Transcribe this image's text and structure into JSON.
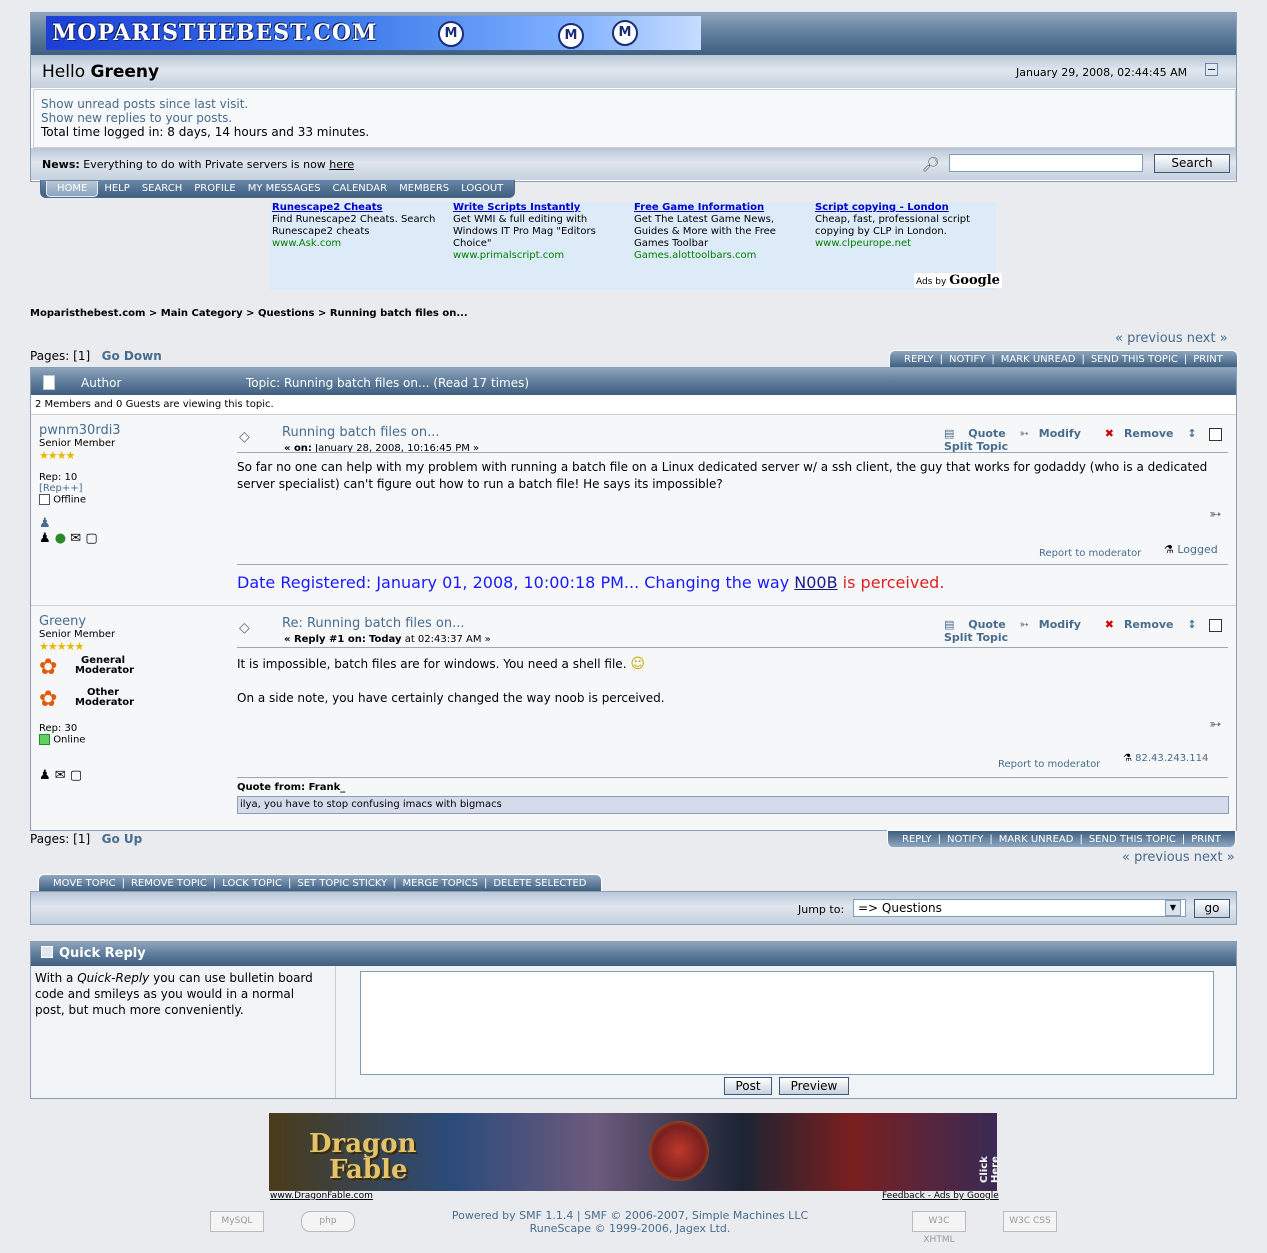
{
  "header": {
    "logo_text": "MOPARISTHEBEST.COM",
    "greeting_prefix": "Hello ",
    "greeting_name": "Greeny",
    "date": "January 29, 2008, 02:44:45 AM",
    "links": [
      "Show unread posts since last visit.",
      "Show new replies to your posts."
    ],
    "time_logged": "Total time logged in: 8 days, 14 hours and 33 minutes.",
    "news_label": "News:",
    "news_text": "Everything to do with Private servers is now",
    "news_link": "here",
    "search_label": "Search"
  },
  "menu": [
    "HOME",
    "HELP",
    "SEARCH",
    "PROFILE",
    "MY MESSAGES",
    "CALENDAR",
    "MEMBERS",
    "LOGOUT"
  ],
  "ads": [
    {
      "title": "Runescape2 Cheats",
      "text": "Find Runescape2 Cheats. Search Runescape2 cheats",
      "url": "www.Ask.com"
    },
    {
      "title": "Write Scripts Instantly",
      "text": "Get WMI & full editing with Windows IT Pro Mag \"Editors Choice\"",
      "url": "www.primalscript.com"
    },
    {
      "title": "Free Game Information",
      "text": "Get The Latest Game News, Guides & More with the Free Games Toolbar",
      "url": "Games.alottoolbars.com"
    },
    {
      "title": "Script copying - London",
      "text": "Cheap, fast, professional script copying by CLP in London.",
      "url": "www.clpeurope.net"
    }
  ],
  "ads_by": "Ads by",
  "ads_google": "Google",
  "breadcrumb": [
    "Moparisthebest.com",
    "Main Category",
    "Questions",
    "Running batch files on..."
  ],
  "prev_next": "« previous next »",
  "pages_label": "Pages: [1]",
  "go_down": "Go Down",
  "go_up": "Go Up",
  "topic_buttons": [
    "REPLY",
    "NOTIFY",
    "MARK UNREAD",
    "SEND THIS TOPIC",
    "PRINT"
  ],
  "topic_header": {
    "author": "Author",
    "topic": "Topic: Running batch files on...  (Read 17 times)"
  },
  "viewing": "2 Members and 0 Guests are viewing this topic.",
  "post_tools": [
    "Quote",
    "Modify",
    "Remove",
    "Split Topic"
  ],
  "posts": [
    {
      "author": "pwnm30rdi3",
      "rank": "Senior Member",
      "rep": "Rep: 10",
      "rep_plus": "[Rep++]",
      "status": "Offline",
      "title": "Running batch files on...",
      "date_prefix": "« on:",
      "date": "January 28, 2008, 10:16:45 PM »",
      "body": "So far no one can help with my problem with running a batch file on a Linux dedicated server w/ a ssh client, the guy that works for godaddy (who is a dedicated server specialist) can't figure out how to run a batch file! He says its impossible?",
      "report": "Report to moderator",
      "ip": "Logged",
      "sig_a": "Date Registered: January 01, 2008, 10:00:18 PM... Changing the way ",
      "sig_link": "N00B",
      "sig_b": " is perceived."
    },
    {
      "author": "Greeny",
      "rank": "Senior Member",
      "badge1": "General Moderator",
      "badge2": "Other Moderator",
      "rep": "Rep: 30",
      "status": "Online",
      "title": "Re: Running batch files on...",
      "date_prefix": "« Reply #1 on:",
      "date_today": "Today",
      "date": "at 02:43:37 AM »",
      "body1": "It is impossible, batch files are for windows. You need a shell file.",
      "body2": "On a side note, you have certainly changed the way noob is perceived.",
      "report": "Report to moderator",
      "ip": "82.43.243.114",
      "quote_from": "Quote from: Frank_",
      "quote_text": "ilya, you have to stop confusing imacs with bigmacs"
    }
  ],
  "mod_buttons": [
    "MOVE TOPIC",
    "REMOVE TOPIC",
    "LOCK TOPIC",
    "SET TOPIC STICKY",
    "MERGE TOPICS",
    "DELETE SELECTED"
  ],
  "jump": {
    "label": "Jump to:",
    "value": "=> Questions",
    "go": "go"
  },
  "quick_reply": {
    "title": "Quick Reply",
    "text_a": "With a ",
    "text_em": "Quick-Reply",
    "text_b": " you can use bulletin board code and smileys as you would in a normal post, but much more conveniently.",
    "post": "Post",
    "preview": "Preview"
  },
  "banner": {
    "text1": "Dragon",
    "text2": "Fable",
    "click": "Click Here",
    "url": "www.DragonFable.com",
    "feedback": "Feedback - Ads by Google"
  },
  "footer": {
    "line1": "Powered by SMF 1.1.4 | SMF © 2006-2007, Simple Machines LLC",
    "line2": "RuneScape © 1999-2006, Jagex Ltd."
  }
}
